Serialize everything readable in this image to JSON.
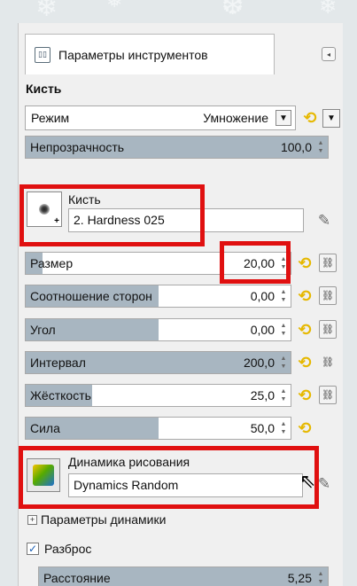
{
  "panel": {
    "tab_title": "Параметры инструментов",
    "tab_icon": "tool-options-icon",
    "menu_icon": "panel-menu-icon"
  },
  "brush_section": {
    "heading": "Кисть",
    "mode_label": "Режим",
    "mode_value": "Умножение",
    "opacity_label": "Непрозрачность",
    "opacity_value": "100,0",
    "brush_label": "Кисть",
    "brush_name": "2. Hardness 025"
  },
  "sliders": {
    "size": {
      "label": "Размер",
      "value": "20,00",
      "fill": 0.065
    },
    "aspect": {
      "label": "Соотношение сторон",
      "value": "0,00",
      "fill": 0.5
    },
    "angle": {
      "label": "Угол",
      "value": "0,00",
      "fill": 0.5
    },
    "spacing": {
      "label": "Интервал",
      "value": "200,0",
      "fill": 1.0
    },
    "hardness": {
      "label": "Жёсткость",
      "value": "25,0",
      "fill": 0.25
    },
    "force": {
      "label": "Сила",
      "value": "50,0",
      "fill": 0.5
    }
  },
  "dynamics": {
    "label": "Динамика рисования",
    "name": "Dynamics Random",
    "options_label": "Параметры динамики"
  },
  "scatter": {
    "label": "Разброс",
    "checked": true,
    "distance_label": "Расстояние",
    "distance_value": "5,25"
  },
  "colors": {
    "highlight": "#e01010",
    "slider_fill": "#a8b6c1",
    "reset_icon": "#e6b800"
  }
}
